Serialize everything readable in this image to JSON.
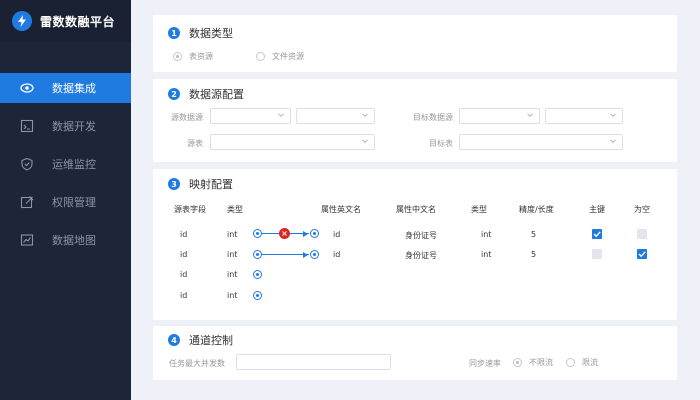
{
  "brand": {
    "title": "雷数数融平台"
  },
  "sidebar": {
    "items": [
      {
        "label": "数据集成",
        "icon": "eye-icon",
        "active": true
      },
      {
        "label": "数据开发",
        "icon": "code-icon",
        "active": false
      },
      {
        "label": "运维监控",
        "icon": "shield-icon",
        "active": false
      },
      {
        "label": "权限管理",
        "icon": "edit-icon",
        "active": false
      },
      {
        "label": "数据地图",
        "icon": "chart-icon",
        "active": false
      }
    ]
  },
  "section1": {
    "num": "1",
    "title": "数据类型",
    "options": [
      {
        "label": "表资源",
        "checked": true
      },
      {
        "label": "文件资源",
        "checked": false
      }
    ]
  },
  "section2": {
    "num": "2",
    "title": "数据源配置",
    "source_db_label": "源数据源",
    "source_table_label": "源表",
    "target_db_label": "目标数据源",
    "target_table_label": "目标表"
  },
  "section3": {
    "num": "3",
    "title": "映射配置",
    "headers": {
      "src_field": "源表字段",
      "src_type": "类型",
      "attr_en": "属性英文名",
      "attr_cn": "属性中文名",
      "tgt_type": "类型",
      "precision": "精度/长度",
      "primary_key": "主键",
      "nullable": "为空"
    },
    "source_rows": [
      {
        "field": "id",
        "type": "int"
      },
      {
        "field": "id",
        "type": "int"
      },
      {
        "field": "id",
        "type": "int"
      },
      {
        "field": "id",
        "type": "int"
      }
    ],
    "target_rows": [
      {
        "attr_en": "id",
        "attr_cn": "身份证号",
        "type": "int",
        "precision": "5",
        "primary_key": true,
        "nullable": false
      },
      {
        "attr_en": "id",
        "attr_cn": "身份证号",
        "type": "int",
        "precision": "5",
        "primary_key": false,
        "nullable": true
      }
    ]
  },
  "section4": {
    "num": "4",
    "title": "通道控制",
    "concurrency_label": "任务最大并发数",
    "sync_rate_label": "同步速率",
    "rate_options": [
      {
        "label": "不限流",
        "checked": true
      },
      {
        "label": "限流",
        "checked": false
      }
    ]
  },
  "colors": {
    "accent": "#1f7be0",
    "sidebar_bg": "#1d2538",
    "danger": "#e02424"
  }
}
